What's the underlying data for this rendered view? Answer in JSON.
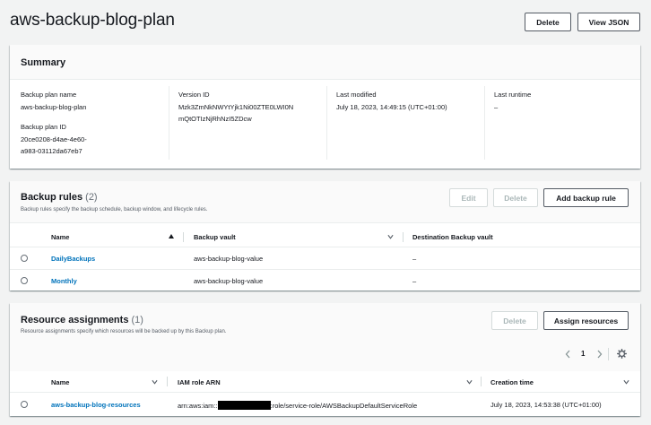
{
  "header": {
    "title": "aws-backup-blog-plan",
    "delete_label": "Delete",
    "view_json_label": "View JSON"
  },
  "summary": {
    "title": "Summary",
    "plan_name_label": "Backup plan name",
    "plan_name_value": "aws-backup-blog-plan",
    "plan_id_label": "Backup plan ID",
    "plan_id_line1": "20ce0208-d4ae-4e60-",
    "plan_id_line2": "a983-03112da67eb7",
    "version_label": "Version ID",
    "version_line1": "Mzk3ZmNkNWYtYjk1Ni00ZTE0LWI0N",
    "version_line2": "mQtOTIzNjRhNzI5ZDcw",
    "modified_label": "Last modified",
    "modified_value": "July 18, 2023, 14:49:15 (UTC+01:00)",
    "runtime_label": "Last runtime",
    "runtime_value": "–"
  },
  "backup_rules": {
    "title": "Backup rules",
    "count": "(2)",
    "description": "Backup rules specify the backup schedule, backup window, and lifecycle rules.",
    "edit_label": "Edit",
    "delete_label": "Delete",
    "add_label": "Add backup rule",
    "columns": [
      "Name",
      "Backup vault",
      "Destination Backup vault"
    ],
    "rows": [
      {
        "name": "DailyBackups",
        "vault": "aws-backup-blog-value",
        "dest": "–"
      },
      {
        "name": "Monthly",
        "vault": "aws-backup-blog-value",
        "dest": "–"
      }
    ]
  },
  "resource_assignments": {
    "title": "Resource assignments",
    "count": "(1)",
    "description": "Resource assignments specify which resources will be backed up by this Backup plan.",
    "delete_label": "Delete",
    "assign_label": "Assign resources",
    "page_number": "1",
    "columns": [
      "Name",
      "IAM role ARN",
      "Creation time"
    ],
    "rows": [
      {
        "name": "aws-backup-blog-resources",
        "arn_prefix": "arn:aws:iam::",
        "arn_suffix": ":role/service-role/AWSBackupDefaultServiceRole",
        "created": "July 18, 2023, 14:53:38 (UTC+01:00)"
      }
    ]
  },
  "icons": {
    "sort": "sort-ascending-icon",
    "filter": "caret-down-icon",
    "prev": "chevron-left-icon",
    "next": "chevron-right-icon",
    "settings": "gear-icon"
  },
  "colors": {
    "background": "#f2f3f3",
    "link": "#0073bb",
    "text": "#16191f",
    "disabled": "#aab7b8"
  }
}
